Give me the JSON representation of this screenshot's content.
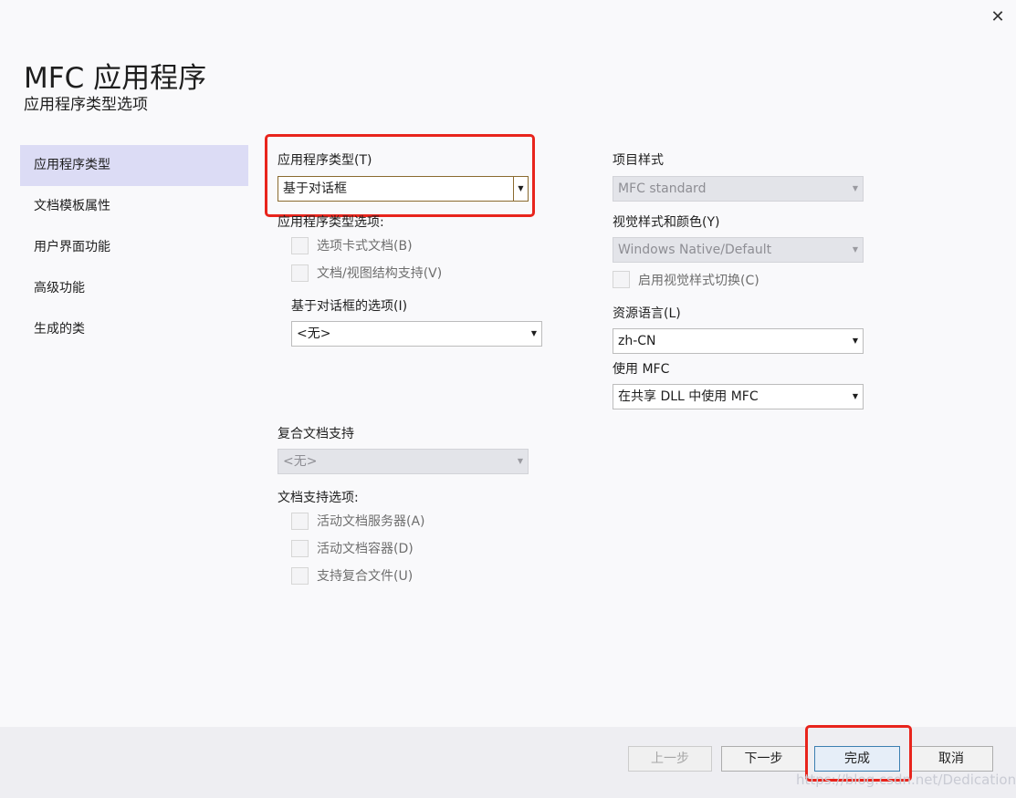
{
  "window": {
    "title": "MFC 应用程序",
    "subtitle": "应用程序类型选项",
    "close_glyph": "✕"
  },
  "sidebar": {
    "items": [
      {
        "label": "应用程序类型",
        "active": true
      },
      {
        "label": "文档模板属性",
        "active": false
      },
      {
        "label": "用户界面功能",
        "active": false
      },
      {
        "label": "高级功能",
        "active": false
      },
      {
        "label": "生成的类",
        "active": false
      }
    ]
  },
  "left": {
    "app_type_label": "应用程序类型(T)",
    "app_type_value": "基于对话框",
    "app_type_options_label": "应用程序类型选项:",
    "tabbed_docs_label": "选项卡式文档(B)",
    "doc_view_label": "文档/视图结构支持(V)",
    "dialog_options_label": "基于对话框的选项(I)",
    "dialog_options_value": "<无>",
    "compound_label": "复合文档支持",
    "compound_value": "<无>",
    "doc_support_label": "文档支持选项:",
    "active_server_label": "活动文档服务器(A)",
    "active_container_label": "活动文档容器(D)",
    "compound_files_label": "支持复合文件(U)"
  },
  "right": {
    "project_style_label": "项目样式",
    "project_style_value": "MFC standard",
    "visual_style_label": "视觉样式和颜色(Y)",
    "visual_style_value": "Windows Native/Default",
    "visual_switch_label": "启用视觉样式切换(C)",
    "resource_lang_label": "资源语言(L)",
    "resource_lang_value": "zh-CN",
    "use_mfc_label": "使用 MFC",
    "use_mfc_value": "在共享 DLL 中使用 MFC"
  },
  "footer": {
    "prev_label": "上一步",
    "next_label": "下一步",
    "finish_label": "完成",
    "cancel_label": "取消"
  },
  "watermark": "https://blog.csdn.net/Dedication_",
  "colors": {
    "highlight_box": "#e8241c",
    "sidebar_active": "#dcdcf5",
    "footer_bg": "#eeeef2"
  }
}
